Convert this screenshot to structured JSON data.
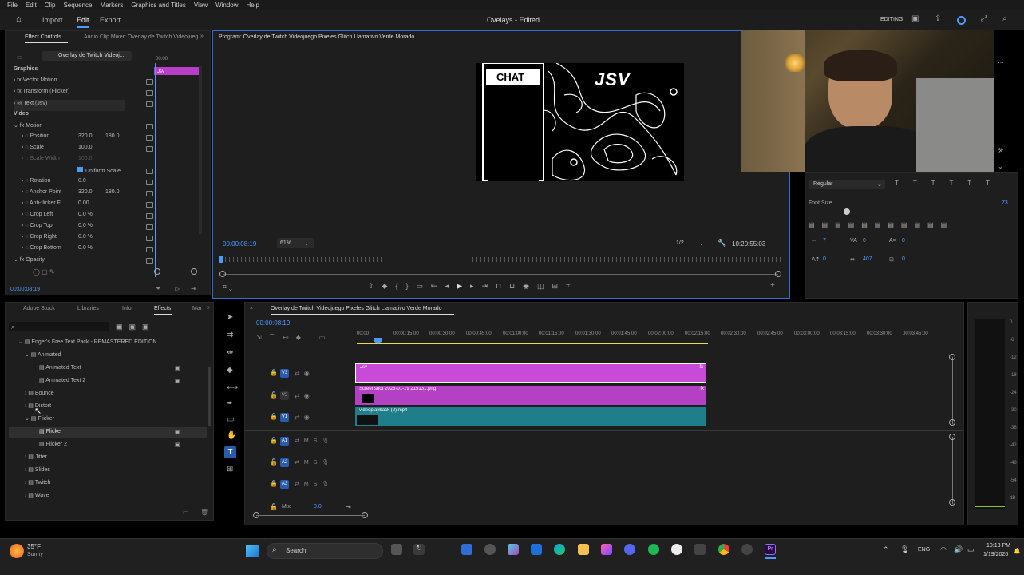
{
  "menu": [
    "File",
    "Edit",
    "Clip",
    "Sequence",
    "Markers",
    "Graphics and Titles",
    "View",
    "Window",
    "Help"
  ],
  "topbar": {
    "import": "Import",
    "edit": "Edit",
    "export": "Export",
    "project_title": "Ovelays - Edited",
    "workspace": "EDITING"
  },
  "effect_controls": {
    "tab_active": "Effect Controls",
    "tab_audio": "Audio Clip Mixer: Overlay de Twitch Videojueg",
    "clip_label": "Overlay de Twitch Videoj...",
    "mini_time": "00:00",
    "clip_name": "Jsv",
    "section_graphics": "Graphics",
    "section_video": "Video",
    "rows": [
      {
        "label": "Vector Motion"
      },
      {
        "label": "Transform (Flicker)"
      },
      {
        "label": "Text (Jsv)"
      },
      {
        "label": "Motion"
      },
      {
        "label": "Position",
        "v1": "320.0",
        "v2": "180.0"
      },
      {
        "label": "Scale",
        "v1": "100.0"
      },
      {
        "label": "Scale Width",
        "v1": "100.0"
      },
      {
        "label": "Uniform Scale"
      },
      {
        "label": "Rotation",
        "v1": "0.0"
      },
      {
        "label": "Anchor Point",
        "v1": "320.0",
        "v2": "180.0"
      },
      {
        "label": "Anti-flicker Fi...",
        "v1": "0.00"
      },
      {
        "label": "Crop Left",
        "v1": "0.0 %"
      },
      {
        "label": "Crop Top",
        "v1": "0.0 %"
      },
      {
        "label": "Crop Right",
        "v1": "0.0 %"
      },
      {
        "label": "Crop Bottom",
        "v1": "0.0 %"
      },
      {
        "label": "Opacity"
      }
    ],
    "timecode": "00:00:08:19"
  },
  "program": {
    "title": "Program: Overlay de Twitch Videojuego Pixeles Glitch Llamativo Verde Morado",
    "chat_text": "CHAT",
    "logo_text": "JSV",
    "timecode": "00:00:08:19",
    "zoom": "61%",
    "resolution": "1/2",
    "duration": "10:20:55:03"
  },
  "properties": {
    "font_style": "Regular",
    "font_size_label": "Font Size",
    "font_size_value": "73",
    "v1": "7",
    "v2": "0",
    "v3": "0",
    "v4": "0",
    "v5": "407",
    "v6": "0"
  },
  "effects_panel": {
    "tabs": [
      "Adobe Stock",
      "Libraries",
      "Info",
      "Effects",
      "Mar"
    ],
    "tree": [
      {
        "label": "Enger's Free Text Pack - REMASTERED EDITION",
        "indent": 0
      },
      {
        "label": "Animated",
        "indent": 1
      },
      {
        "label": "Animated Text",
        "indent": 2
      },
      {
        "label": "Animated Text 2",
        "indent": 2
      },
      {
        "label": "Bounce",
        "indent": 1
      },
      {
        "label": "Distort",
        "indent": 1
      },
      {
        "label": "Flicker",
        "indent": 1
      },
      {
        "label": "Flicker",
        "indent": 2,
        "selected": true
      },
      {
        "label": "Flicker 2",
        "indent": 2
      },
      {
        "label": "Jitter",
        "indent": 1
      },
      {
        "label": "Slides",
        "indent": 1
      },
      {
        "label": "Twitch",
        "indent": 1
      },
      {
        "label": "Wave",
        "indent": 1
      }
    ]
  },
  "timeline": {
    "title": "Overlay de Twitch Videojuego Pixeles Glitch Llamativo Verde Morado",
    "timecode": "00:00:08:19",
    "ruler": [
      "00:00",
      "00:00:15:00",
      "00:00:30:00",
      "00:00:45:00",
      "00:01:00:00",
      "00:01:15:00",
      "00:01:30:00",
      "00:01:45:00",
      "00:02:00:00",
      "00:02:15:00",
      "00:02:30:00",
      "00:02:45:00",
      "00:03:00:00",
      "00:03:15:00",
      "00:03:30:00",
      "00:03:45:00"
    ],
    "tracks_video": [
      "V3",
      "V2",
      "V1"
    ],
    "tracks_audio": [
      "A1",
      "A2",
      "A3"
    ],
    "clip_v3": "Jsv",
    "clip_v2": "Screenshot 2026-01-19 215131.png",
    "clip_v1": "videoplayback (2).mp4",
    "mix_label": "Mix",
    "mix_value": "0.0"
  },
  "meter": {
    "scale": [
      "0",
      "-6",
      "-12",
      "-18",
      "-24",
      "-30",
      "-36",
      "-42",
      "-48",
      "-54",
      "dB"
    ]
  },
  "taskbar": {
    "temp": "35°F",
    "weather": "Sunny",
    "search": "Search",
    "lang": "ENG",
    "time": "10:13 PM",
    "date": "1/19/2026"
  },
  "colors": {
    "accent": "#4d9bff",
    "clip_pink": "#c94ad6",
    "clip_teal": "#1e7f8a",
    "yellow": "#e8d84a"
  }
}
